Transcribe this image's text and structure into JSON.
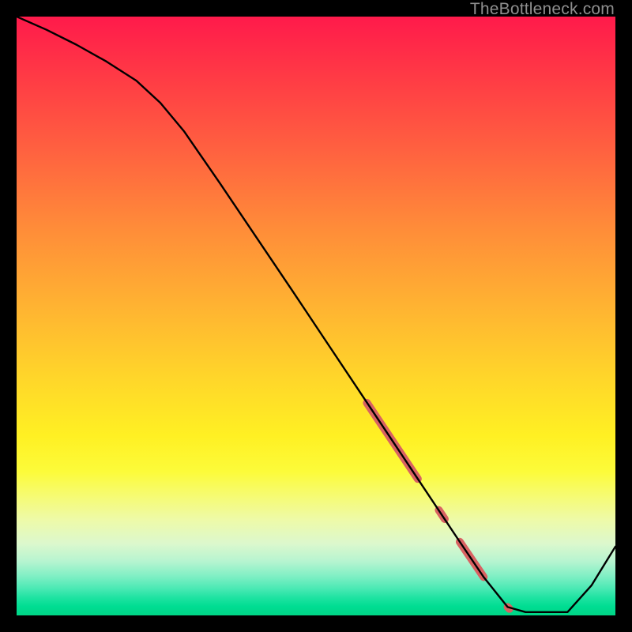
{
  "watermark": "TheBottleneck.com",
  "chart_data": {
    "type": "line",
    "title": "",
    "xlabel": "",
    "ylabel": "",
    "xlim": [
      0,
      100
    ],
    "ylim": [
      0,
      100
    ],
    "grid": false,
    "legend": false,
    "series": [
      {
        "name": "curve",
        "x": [
          0,
          5,
          10,
          15,
          20,
          24,
          28,
          34,
          40,
          46,
          52,
          58,
          62,
          66,
          70,
          74,
          78,
          82,
          85,
          88,
          92,
          96,
          100
        ],
        "y": [
          100,
          97.8,
          95.3,
          92.5,
          89.3,
          85.6,
          80.8,
          72.1,
          63.2,
          54.3,
          45.3,
          36.3,
          30.3,
          24.3,
          18.3,
          12.3,
          6.4,
          1.4,
          0.55,
          0.55,
          0.55,
          5.0,
          11.5
        ]
      }
    ],
    "highlights": [
      {
        "x0": 58.5,
        "y0": 35.5,
        "x1": 67.0,
        "y1": 22.8,
        "r": 5.0
      },
      {
        "x0": 70.5,
        "y0": 17.6,
        "x1": 71.5,
        "y1": 16.1,
        "r": 5.0
      },
      {
        "x0": 74.0,
        "y0": 12.3,
        "x1": 78.0,
        "y1": 6.4,
        "r": 5.0
      },
      {
        "x0": 82.0,
        "y0": 1.4,
        "x1": 82.3,
        "y1": 1.1,
        "r": 5.0
      }
    ],
    "highlight_color": "#d86262"
  }
}
